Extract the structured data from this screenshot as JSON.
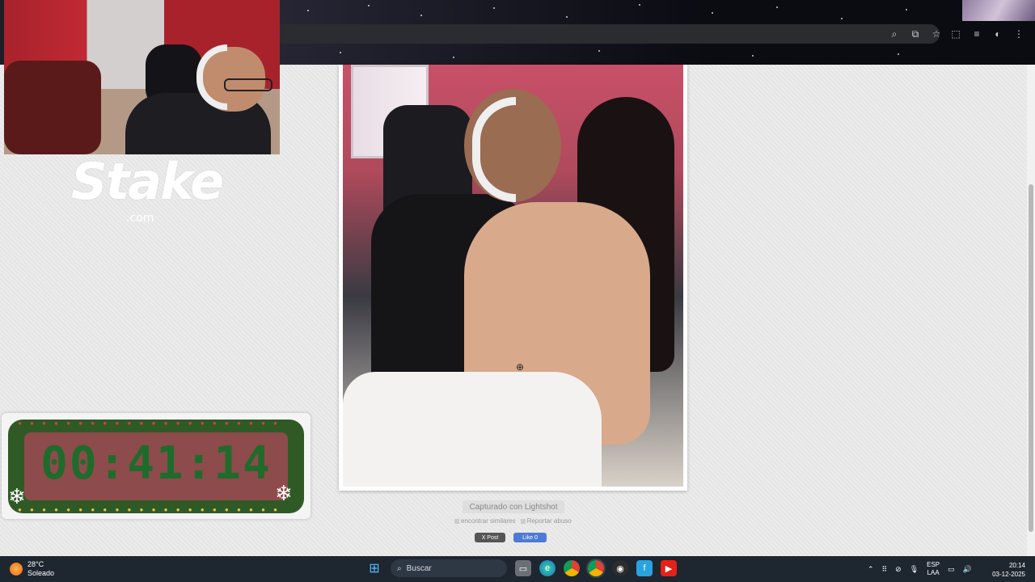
{
  "browser": {
    "toolbar_icons": [
      "zoom-icon",
      "install-icon",
      "star-icon",
      "extensions-icon",
      "media-icon",
      "profile-icon",
      "menu-icon"
    ]
  },
  "overlay": {
    "logo_text": "Stake",
    "logo_suffix": ".com",
    "timer": "00:41:14"
  },
  "lightshot": {
    "captured_label": "Capturado con Lightshot",
    "find_similar": "encontrar similares",
    "report_abuse": "Reportar abuso",
    "x_post": "X Post",
    "fb_like": "Like 0"
  },
  "taskbar": {
    "temperature": "28°C",
    "weather_desc": "Soleado",
    "search_placeholder": "Buscar",
    "lang_1": "ESP",
    "lang_2": "LAA",
    "time": "20:14",
    "date": "03-12-2025"
  }
}
